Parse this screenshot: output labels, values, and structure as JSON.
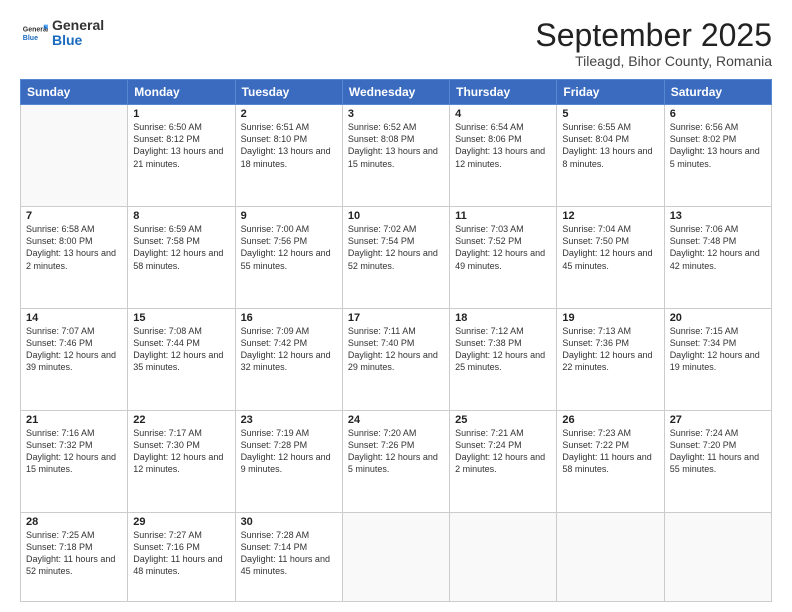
{
  "header": {
    "logo_general": "General",
    "logo_blue": "Blue",
    "month": "September 2025",
    "location": "Tileagd, Bihor County, Romania"
  },
  "days_of_week": [
    "Sunday",
    "Monday",
    "Tuesday",
    "Wednesday",
    "Thursday",
    "Friday",
    "Saturday"
  ],
  "weeks": [
    [
      {
        "day": "",
        "detail": ""
      },
      {
        "day": "1",
        "detail": "Sunrise: 6:50 AM\nSunset: 8:12 PM\nDaylight: 13 hours\nand 21 minutes."
      },
      {
        "day": "2",
        "detail": "Sunrise: 6:51 AM\nSunset: 8:10 PM\nDaylight: 13 hours\nand 18 minutes."
      },
      {
        "day": "3",
        "detail": "Sunrise: 6:52 AM\nSunset: 8:08 PM\nDaylight: 13 hours\nand 15 minutes."
      },
      {
        "day": "4",
        "detail": "Sunrise: 6:54 AM\nSunset: 8:06 PM\nDaylight: 13 hours\nand 12 minutes."
      },
      {
        "day": "5",
        "detail": "Sunrise: 6:55 AM\nSunset: 8:04 PM\nDaylight: 13 hours\nand 8 minutes."
      },
      {
        "day": "6",
        "detail": "Sunrise: 6:56 AM\nSunset: 8:02 PM\nDaylight: 13 hours\nand 5 minutes."
      }
    ],
    [
      {
        "day": "7",
        "detail": "Sunrise: 6:58 AM\nSunset: 8:00 PM\nDaylight: 13 hours\nand 2 minutes."
      },
      {
        "day": "8",
        "detail": "Sunrise: 6:59 AM\nSunset: 7:58 PM\nDaylight: 12 hours\nand 58 minutes."
      },
      {
        "day": "9",
        "detail": "Sunrise: 7:00 AM\nSunset: 7:56 PM\nDaylight: 12 hours\nand 55 minutes."
      },
      {
        "day": "10",
        "detail": "Sunrise: 7:02 AM\nSunset: 7:54 PM\nDaylight: 12 hours\nand 52 minutes."
      },
      {
        "day": "11",
        "detail": "Sunrise: 7:03 AM\nSunset: 7:52 PM\nDaylight: 12 hours\nand 49 minutes."
      },
      {
        "day": "12",
        "detail": "Sunrise: 7:04 AM\nSunset: 7:50 PM\nDaylight: 12 hours\nand 45 minutes."
      },
      {
        "day": "13",
        "detail": "Sunrise: 7:06 AM\nSunset: 7:48 PM\nDaylight: 12 hours\nand 42 minutes."
      }
    ],
    [
      {
        "day": "14",
        "detail": "Sunrise: 7:07 AM\nSunset: 7:46 PM\nDaylight: 12 hours\nand 39 minutes."
      },
      {
        "day": "15",
        "detail": "Sunrise: 7:08 AM\nSunset: 7:44 PM\nDaylight: 12 hours\nand 35 minutes."
      },
      {
        "day": "16",
        "detail": "Sunrise: 7:09 AM\nSunset: 7:42 PM\nDaylight: 12 hours\nand 32 minutes."
      },
      {
        "day": "17",
        "detail": "Sunrise: 7:11 AM\nSunset: 7:40 PM\nDaylight: 12 hours\nand 29 minutes."
      },
      {
        "day": "18",
        "detail": "Sunrise: 7:12 AM\nSunset: 7:38 PM\nDaylight: 12 hours\nand 25 minutes."
      },
      {
        "day": "19",
        "detail": "Sunrise: 7:13 AM\nSunset: 7:36 PM\nDaylight: 12 hours\nand 22 minutes."
      },
      {
        "day": "20",
        "detail": "Sunrise: 7:15 AM\nSunset: 7:34 PM\nDaylight: 12 hours\nand 19 minutes."
      }
    ],
    [
      {
        "day": "21",
        "detail": "Sunrise: 7:16 AM\nSunset: 7:32 PM\nDaylight: 12 hours\nand 15 minutes."
      },
      {
        "day": "22",
        "detail": "Sunrise: 7:17 AM\nSunset: 7:30 PM\nDaylight: 12 hours\nand 12 minutes."
      },
      {
        "day": "23",
        "detail": "Sunrise: 7:19 AM\nSunset: 7:28 PM\nDaylight: 12 hours\nand 9 minutes."
      },
      {
        "day": "24",
        "detail": "Sunrise: 7:20 AM\nSunset: 7:26 PM\nDaylight: 12 hours\nand 5 minutes."
      },
      {
        "day": "25",
        "detail": "Sunrise: 7:21 AM\nSunset: 7:24 PM\nDaylight: 12 hours\nand 2 minutes."
      },
      {
        "day": "26",
        "detail": "Sunrise: 7:23 AM\nSunset: 7:22 PM\nDaylight: 11 hours\nand 58 minutes."
      },
      {
        "day": "27",
        "detail": "Sunrise: 7:24 AM\nSunset: 7:20 PM\nDaylight: 11 hours\nand 55 minutes."
      }
    ],
    [
      {
        "day": "28",
        "detail": "Sunrise: 7:25 AM\nSunset: 7:18 PM\nDaylight: 11 hours\nand 52 minutes."
      },
      {
        "day": "29",
        "detail": "Sunrise: 7:27 AM\nSunset: 7:16 PM\nDaylight: 11 hours\nand 48 minutes."
      },
      {
        "day": "30",
        "detail": "Sunrise: 7:28 AM\nSunset: 7:14 PM\nDaylight: 11 hours\nand 45 minutes."
      },
      {
        "day": "",
        "detail": ""
      },
      {
        "day": "",
        "detail": ""
      },
      {
        "day": "",
        "detail": ""
      },
      {
        "day": "",
        "detail": ""
      }
    ]
  ]
}
